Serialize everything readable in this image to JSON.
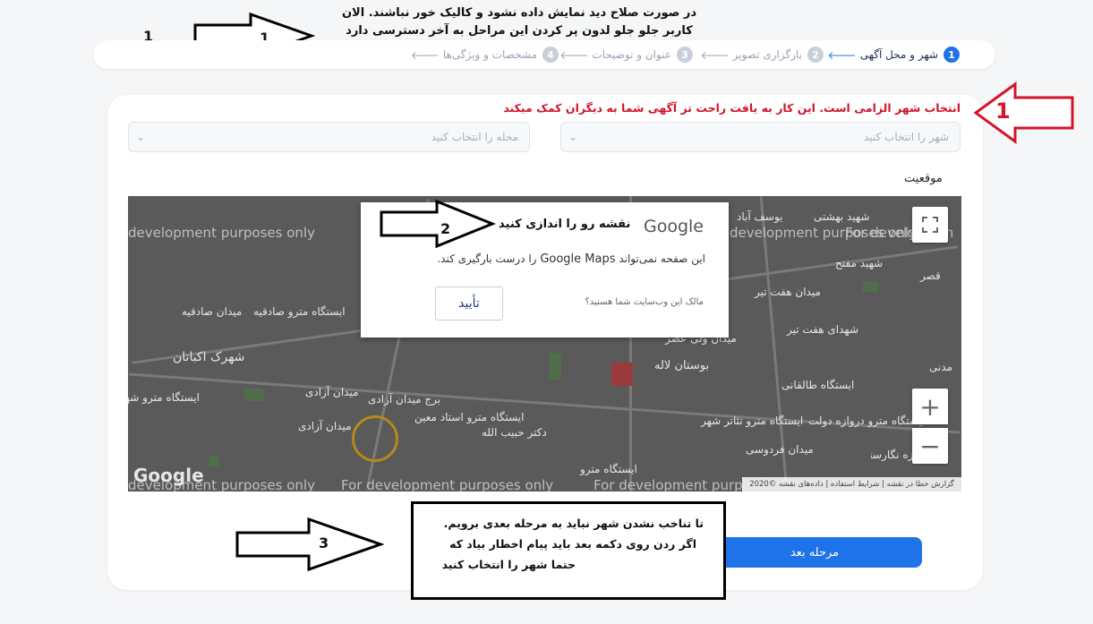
{
  "annotations": {
    "note1_line1": "در صورت صلاح دید نمایش داده نشود و کالیک خور نباشند. الان",
    "note1_line2": "کاربر جلو جلو لدون پر کردن این مراحل به آخر دسترسی دارد",
    "label_1_left": "1",
    "arrow_1_label": "1",
    "red_note": "انتخاب شهر الزامی است. این کار به یافت راحت تر آگهی شما به دیگران کمک میکند",
    "red_arrow_label": "1",
    "arrow_2_label": "2",
    "arrow_2_text": "نقشه رو را اندازی کنید",
    "arrow_3_label": "3",
    "box3_line1": "تا تناخب نشدن شهر نباید به مرحله بعدی برویم.",
    "box3_line2": "اگر ردن روی دکمه بعد باید پیام اخطار بیاد  که",
    "box3_line3": "حتما شهر را انتخاب کنید"
  },
  "stepper": {
    "steps": [
      {
        "num": "1",
        "label": "شهر و محل آگهی",
        "active": true
      },
      {
        "num": "2",
        "label": "بارگزاری تصویر",
        "active": false
      },
      {
        "num": "3",
        "label": "عنوان و توضیحات",
        "active": false
      },
      {
        "num": "4",
        "label": "مشخصات و ویژگی‌ها",
        "active": false
      }
    ],
    "arrow": "🡐"
  },
  "form": {
    "city_placeholder": "شهر را انتخاب کنید",
    "district_placeholder": "محله را انتخاب کنید",
    "location_label": "موقعیت"
  },
  "map": {
    "dev_text": "For development purposes only",
    "dev_text_partial": "development purposes only",
    "labels": {
      "shahrak_ekbatan": "شهرک اکباتان",
      "shahrak_ekbatan_small": "شهرک اکباتان",
      "metro_sadeghieh": "ایستگاه مترو صادقیه",
      "meydan_sadeghieh": "میدان صادقیه",
      "azadi_tower": "برج میدان آزادی",
      "meydan_azadi": "میدان آزادی",
      "meydan_azadi2": "میدان آزادی",
      "station_azadi": "ایستگاه مترو شهرک آزادی",
      "ostad_moein": "ایستگاه مترو استاد معین",
      "dr_habibollah": "دکتر حبیب الله",
      "boostan_laleh": "بوستان لاله",
      "meydan_valiasr": "میدان ولی عصر",
      "shohada_haftetir": "شهدای هفت تیر",
      "station_taleghani": "ایستگاه طالقانی",
      "station_tehran_theater": "ایستگاه مترو تئاتر شهر",
      "darvazeh_dowlat": "ایستگاه مترو دروازه دولت",
      "meydan_ferdowsi": "میدان فردوسی",
      "shahid_beheshti": "شهید بهشتی",
      "shahid_mofatteh": "شهید مفتح",
      "meydan_hafttir": "میدان هفت تیر",
      "yousef_abad": "یوسف آباد",
      "bagh_negarestan": "باغ موزه نگارستان",
      "madani": "مدنی",
      "station_metro": "ایستگاه مترو",
      "ghasr": "قصر"
    },
    "dialog": {
      "google": "Google",
      "message_pre": "این صفحه نمی‌تواند",
      "message_brand": "Google Maps",
      "message_post": "را درست بارگیری کند.",
      "owner_q": "مالک این وب‌سایت شما هستید؟",
      "ok": "تأیید"
    },
    "attribution": "گزارش خطا در نقشه  |  شرایط استفاده  |  داده‌های نقشه ©2020",
    "google_logo": "Google",
    "zoom_in": "+",
    "zoom_out": "−"
  },
  "next_button": "مرحله بعد",
  "colors": {
    "primary": "#1f73e8",
    "red_note": "#d3152b"
  }
}
